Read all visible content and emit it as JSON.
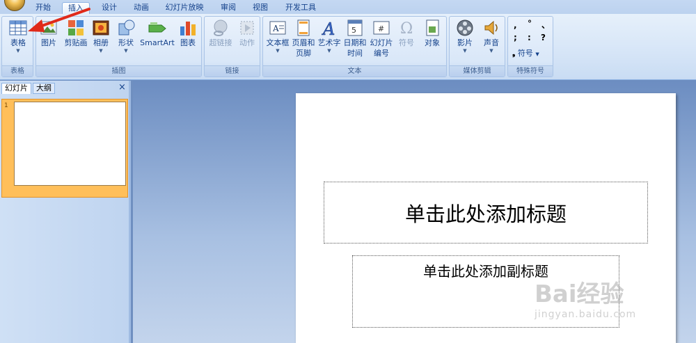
{
  "tabs": [
    "开始",
    "插入",
    "设计",
    "动画",
    "幻灯片放映",
    "审阅",
    "视图",
    "开发工具"
  ],
  "active_tab": "插入",
  "groups": {
    "table": {
      "label": "表格",
      "buttons": [
        "表格"
      ]
    },
    "illustrations": {
      "label": "插图",
      "buttons": [
        "图片",
        "剪贴画",
        "相册",
        "形状",
        "SmartArt",
        "图表"
      ]
    },
    "links": {
      "label": "链接",
      "buttons": [
        "超链接",
        "动作"
      ]
    },
    "text": {
      "label": "文本",
      "buttons": [
        [
          "文本框"
        ],
        [
          "页眉和",
          "页脚"
        ],
        [
          "艺术字"
        ],
        [
          "日期和",
          "时间"
        ],
        [
          "幻灯片",
          "编号"
        ],
        [
          "符号"
        ],
        [
          "对象"
        ]
      ]
    },
    "media": {
      "label": "媒体剪辑",
      "buttons": [
        "影片",
        "声音"
      ]
    },
    "special": {
      "label": "特殊符号",
      "symbols": [
        ",",
        "°",
        "、",
        ";",
        ":",
        "?"
      ],
      "button": "符号"
    }
  },
  "panel": {
    "tab_slides": "幻灯片",
    "tab_outline": "大纲",
    "close": "×",
    "slide_number": "1"
  },
  "slide": {
    "title_placeholder": "单击此处添加标题",
    "subtitle_placeholder": "单击此处添加副标题"
  },
  "watermark": {
    "brand": "Bai经验",
    "url": "jingyan.baidu.com"
  },
  "colors": {
    "arrow": "#e02a1a",
    "selected_thumb": "#ffbf5a"
  }
}
